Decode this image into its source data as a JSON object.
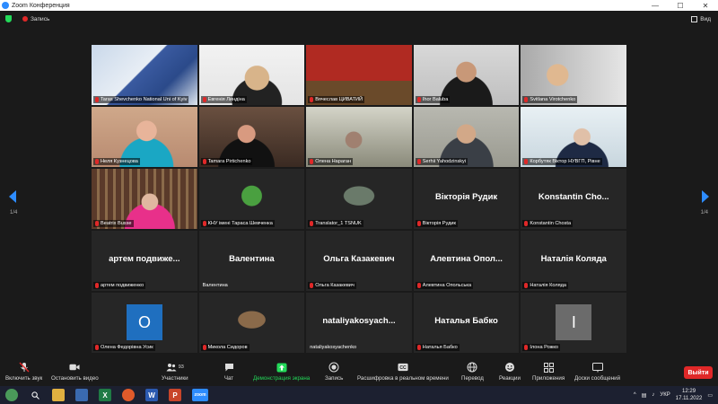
{
  "window": {
    "title": "Zoom Конференция",
    "minimize": "—",
    "maximize": "☐",
    "close": "✕"
  },
  "topbar": {
    "recording": "Запись",
    "view": "Вид"
  },
  "pager": {
    "left": "1/4",
    "right": "1/4"
  },
  "tiles": [
    [
      {
        "label": "Taras Shevchenko National Uni of Kyiv",
        "video": "presenter"
      },
      {
        "label": "Евгенія Линдіна",
        "video": "woman-light"
      },
      {
        "label": "Вячеслав ЦИВАТИЙ",
        "video": "building"
      },
      {
        "label": "Ihor Baluba",
        "video": "man-glasses"
      },
      {
        "label": "Svitlana Virotchenko",
        "video": "woman-blur"
      }
    ],
    [
      {
        "label": "Неля Кузнецова",
        "video": "woman-red"
      },
      {
        "label": "Tamara Pirtichenko",
        "video": "woman-dark"
      },
      {
        "label": "Олена Нараган",
        "video": "man-dim"
      },
      {
        "label": "Serhii Yahodzinskyi",
        "video": "man-active",
        "active": true
      },
      {
        "label": "Корбутяк Віктор НУВГП, Рівне",
        "video": "man-office"
      }
    ],
    [
      {
        "label": "Beatrix Busse",
        "video": "woman-books"
      },
      {
        "label": "КНУ імені Тараса Шевченка",
        "video": "tree-logo"
      },
      {
        "label": "Translator_1 TSNUK",
        "video": "keyboard"
      },
      {
        "label": "Вікторія Рудик",
        "big": "Вікторія Рудик"
      },
      {
        "label": "Konstantin Chosta",
        "big": "Konstantin Cho..."
      }
    ],
    [
      {
        "label": "артем подвиженко",
        "big": "артем подвиже..."
      },
      {
        "label": "Валентина",
        "big": "Валентина",
        "plain": true
      },
      {
        "label": "Ольга Казакевич",
        "big": "Ольга Казакевич"
      },
      {
        "label": "Алевтина Опольська",
        "big": "Алевтина Опол..."
      },
      {
        "label": "Наталія Коляда",
        "big": "Наталія Коляда"
      }
    ],
    [
      {
        "label": "Олена Федорівна Усик",
        "avatar": "O",
        "avatar_color": "#1f6fbf"
      },
      {
        "label": "Микола Сидоров",
        "video": "portrait-small"
      },
      {
        "label": "nataliyakosyachenko",
        "big": "nataliyakosyach...",
        "plain": true
      },
      {
        "label": "Наталья Бабко",
        "big": "Наталья Бабко"
      },
      {
        "label": "Ілона Рожко",
        "avatar": "I",
        "avatar_color": "#6b6b6b"
      }
    ]
  ],
  "toolbar": {
    "audio": "Включить звук",
    "video": "Остановить видео",
    "participants": "Участники",
    "participants_count": "93",
    "chat": "Чат",
    "share": "Демонстрация экрана",
    "record": "Запись",
    "transcript": "Расшифровка в реальном времени",
    "translate": "Перевод",
    "reactions": "Реакции",
    "apps": "Приложения",
    "whiteboard": "Доски сообщений",
    "leave": "Выйти"
  },
  "taskbar": {
    "lang": "УКР",
    "time": "12:29",
    "date": "17.11.2022"
  },
  "colors": {
    "accent": "#2d8cff",
    "active_speaker": "#bfe85a",
    "leave": "#e02828",
    "share": "#23d959"
  }
}
